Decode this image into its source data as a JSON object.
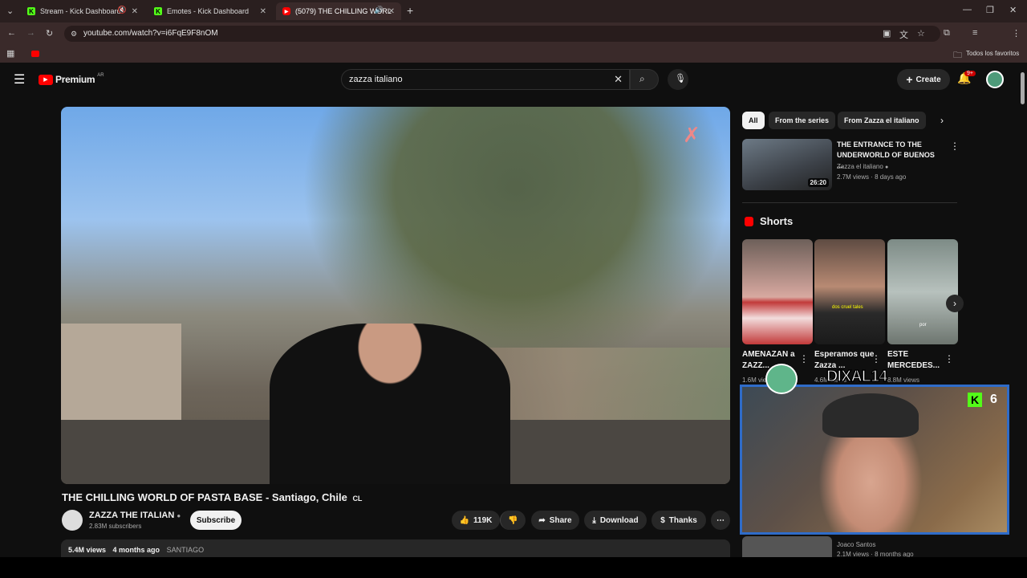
{
  "browser": {
    "tabs": [
      {
        "label": "Stream - Kick Dashboard",
        "favicon": "kick-icon",
        "color": "#53fc18"
      },
      {
        "label": "Emotes - Kick Dashboard",
        "favicon": "kick-icon",
        "color": "#53fc18"
      },
      {
        "label": "(5079) THE CHILLING WORL",
        "favicon": "youtube-icon",
        "color": "#ff0000"
      }
    ],
    "new_tab_label": "+",
    "url": "youtube.com/watch?v=i6FqE9F8nOM",
    "bookmarks_label": "Todos los favoritos"
  },
  "youtube": {
    "logo": "Premium",
    "logo_region": "AR",
    "search_value": "zazza italiano",
    "create_label": "Create",
    "notif_badge": "9+"
  },
  "video": {
    "title": "THE CHILLING WORLD OF PASTA BASE - Santiago, Chile",
    "title_suffix": "CL",
    "channel": "ZAZZA THE ITALIAN",
    "subscribers": "2.83M subscribers",
    "subscribe_label": "Subscribe",
    "likes": "119K",
    "share_label": "Share",
    "download_label": "Download",
    "thanks_label": "Thanks",
    "views": "5.4M views",
    "age": "4 months ago",
    "location": "SANTIAGO"
  },
  "sidebar": {
    "chips": [
      "All",
      "From the series",
      "From Zazza el italiano"
    ],
    "rec1": {
      "title": "THE ENTRANCE TO THE UNDERWORLD OF BUENOS ...",
      "channel": "Zazza el italiano",
      "meta": "2.7M views · 8 days ago",
      "duration": "26:20"
    },
    "shorts_heading": "Shorts",
    "shorts": [
      {
        "title": "AMENAZAN a ZAZZ...",
        "views": "1.6M views"
      },
      {
        "title": "Esperamos que Zazza ...",
        "views": "4.6M views"
      },
      {
        "title": "ESTE MERCEDES...",
        "views": "8.8M views"
      }
    ],
    "short2_caption": "dos cruel tales",
    "short3_caption": "por",
    "rec2": {
      "channel": "Joaco Santos",
      "meta": "2.1M views · 8 months ago"
    }
  },
  "overlay": {
    "streamer_name": "DIXAL14",
    "kick_count": "6",
    "kick_letter": "K",
    "border_color": "#2f6cc9"
  }
}
